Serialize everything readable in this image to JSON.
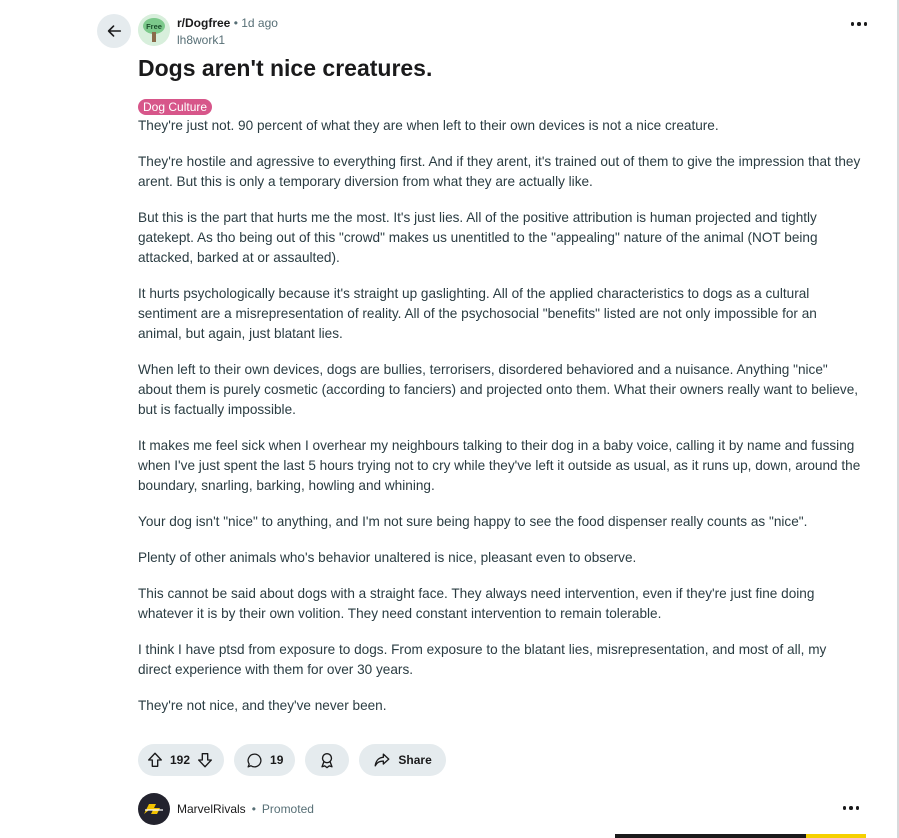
{
  "post": {
    "subreddit": "r/Dogfree",
    "separator": "•",
    "time": "1d ago",
    "author": "lh8work1",
    "avatar_text": "Free",
    "title": "Dogs aren't nice creatures.",
    "flair": "Dog Culture",
    "flair_color": "#d7568a",
    "paragraphs": [
      "They're just not. 90 percent of what they are when left to their own devices is not a nice creature.",
      "They're hostile and agressive to everything first. And if they arent, it's trained out of them to give the impression that they arent. But this is only a temporary diversion from what they are actually like.",
      "But this is the part that hurts me the most. It's just lies. All of the positive attribution is human projected and tightly gatekept. As tho being out of this \"crowd\" makes us unentitled to the \"appealing\" nature of the animal (NOT being attacked, barked at or assaulted).",
      "It hurts psychologically because it's straight up gaslighting. All of the applied characteristics to dogs as a cultural sentiment are a misrepresentation of reality. All of the psychosocial \"benefits\" listed are not only impossible for an animal, but again, just blatant lies.",
      "When left to their own devices, dogs are bullies, terrorisers, disordered behaviored and a nuisance. Anything \"nice\" about them is purely cosmetic (according to fanciers) and projected onto them. What their owners really want to believe, but is factually impossible.",
      "It makes me feel sick when I overhear my neighbours talking to their dog in a baby voice, calling it by name and fussing when I've just spent the last 5 hours trying not to cry while they've left it outside as usual, as it runs up, down, around the boundary, snarling, barking, howling and whining.",
      "Your dog isn't \"nice\" to anything, and I'm not sure being happy to see the food dispenser really counts as \"nice\".",
      "Plenty of other animals who's behavior unaltered is nice, pleasant even to observe.",
      "This cannot be said about dogs with a straight face. They always need intervention, even if they're just fine doing whatever it is by their own volition. They need constant intervention to remain tolerable.",
      "I think I have ptsd from exposure to dogs. From exposure to the blatant lies, misrepresentation, and most of all, my direct experience with them for over 30 years.",
      "They're not nice, and they've never been."
    ]
  },
  "actions": {
    "votes": "192",
    "comments": "19",
    "share_label": "Share"
  },
  "promoted": {
    "name": "MarvelRivals",
    "separator": "•",
    "label": "Promoted"
  },
  "icons": {
    "back": "arrow-left-icon",
    "more": "ellipsis-icon",
    "upvote": "arrow-up-icon",
    "downvote": "arrow-down-icon",
    "comment": "speech-bubble-icon",
    "award": "award-icon",
    "share": "share-arrow-icon"
  }
}
